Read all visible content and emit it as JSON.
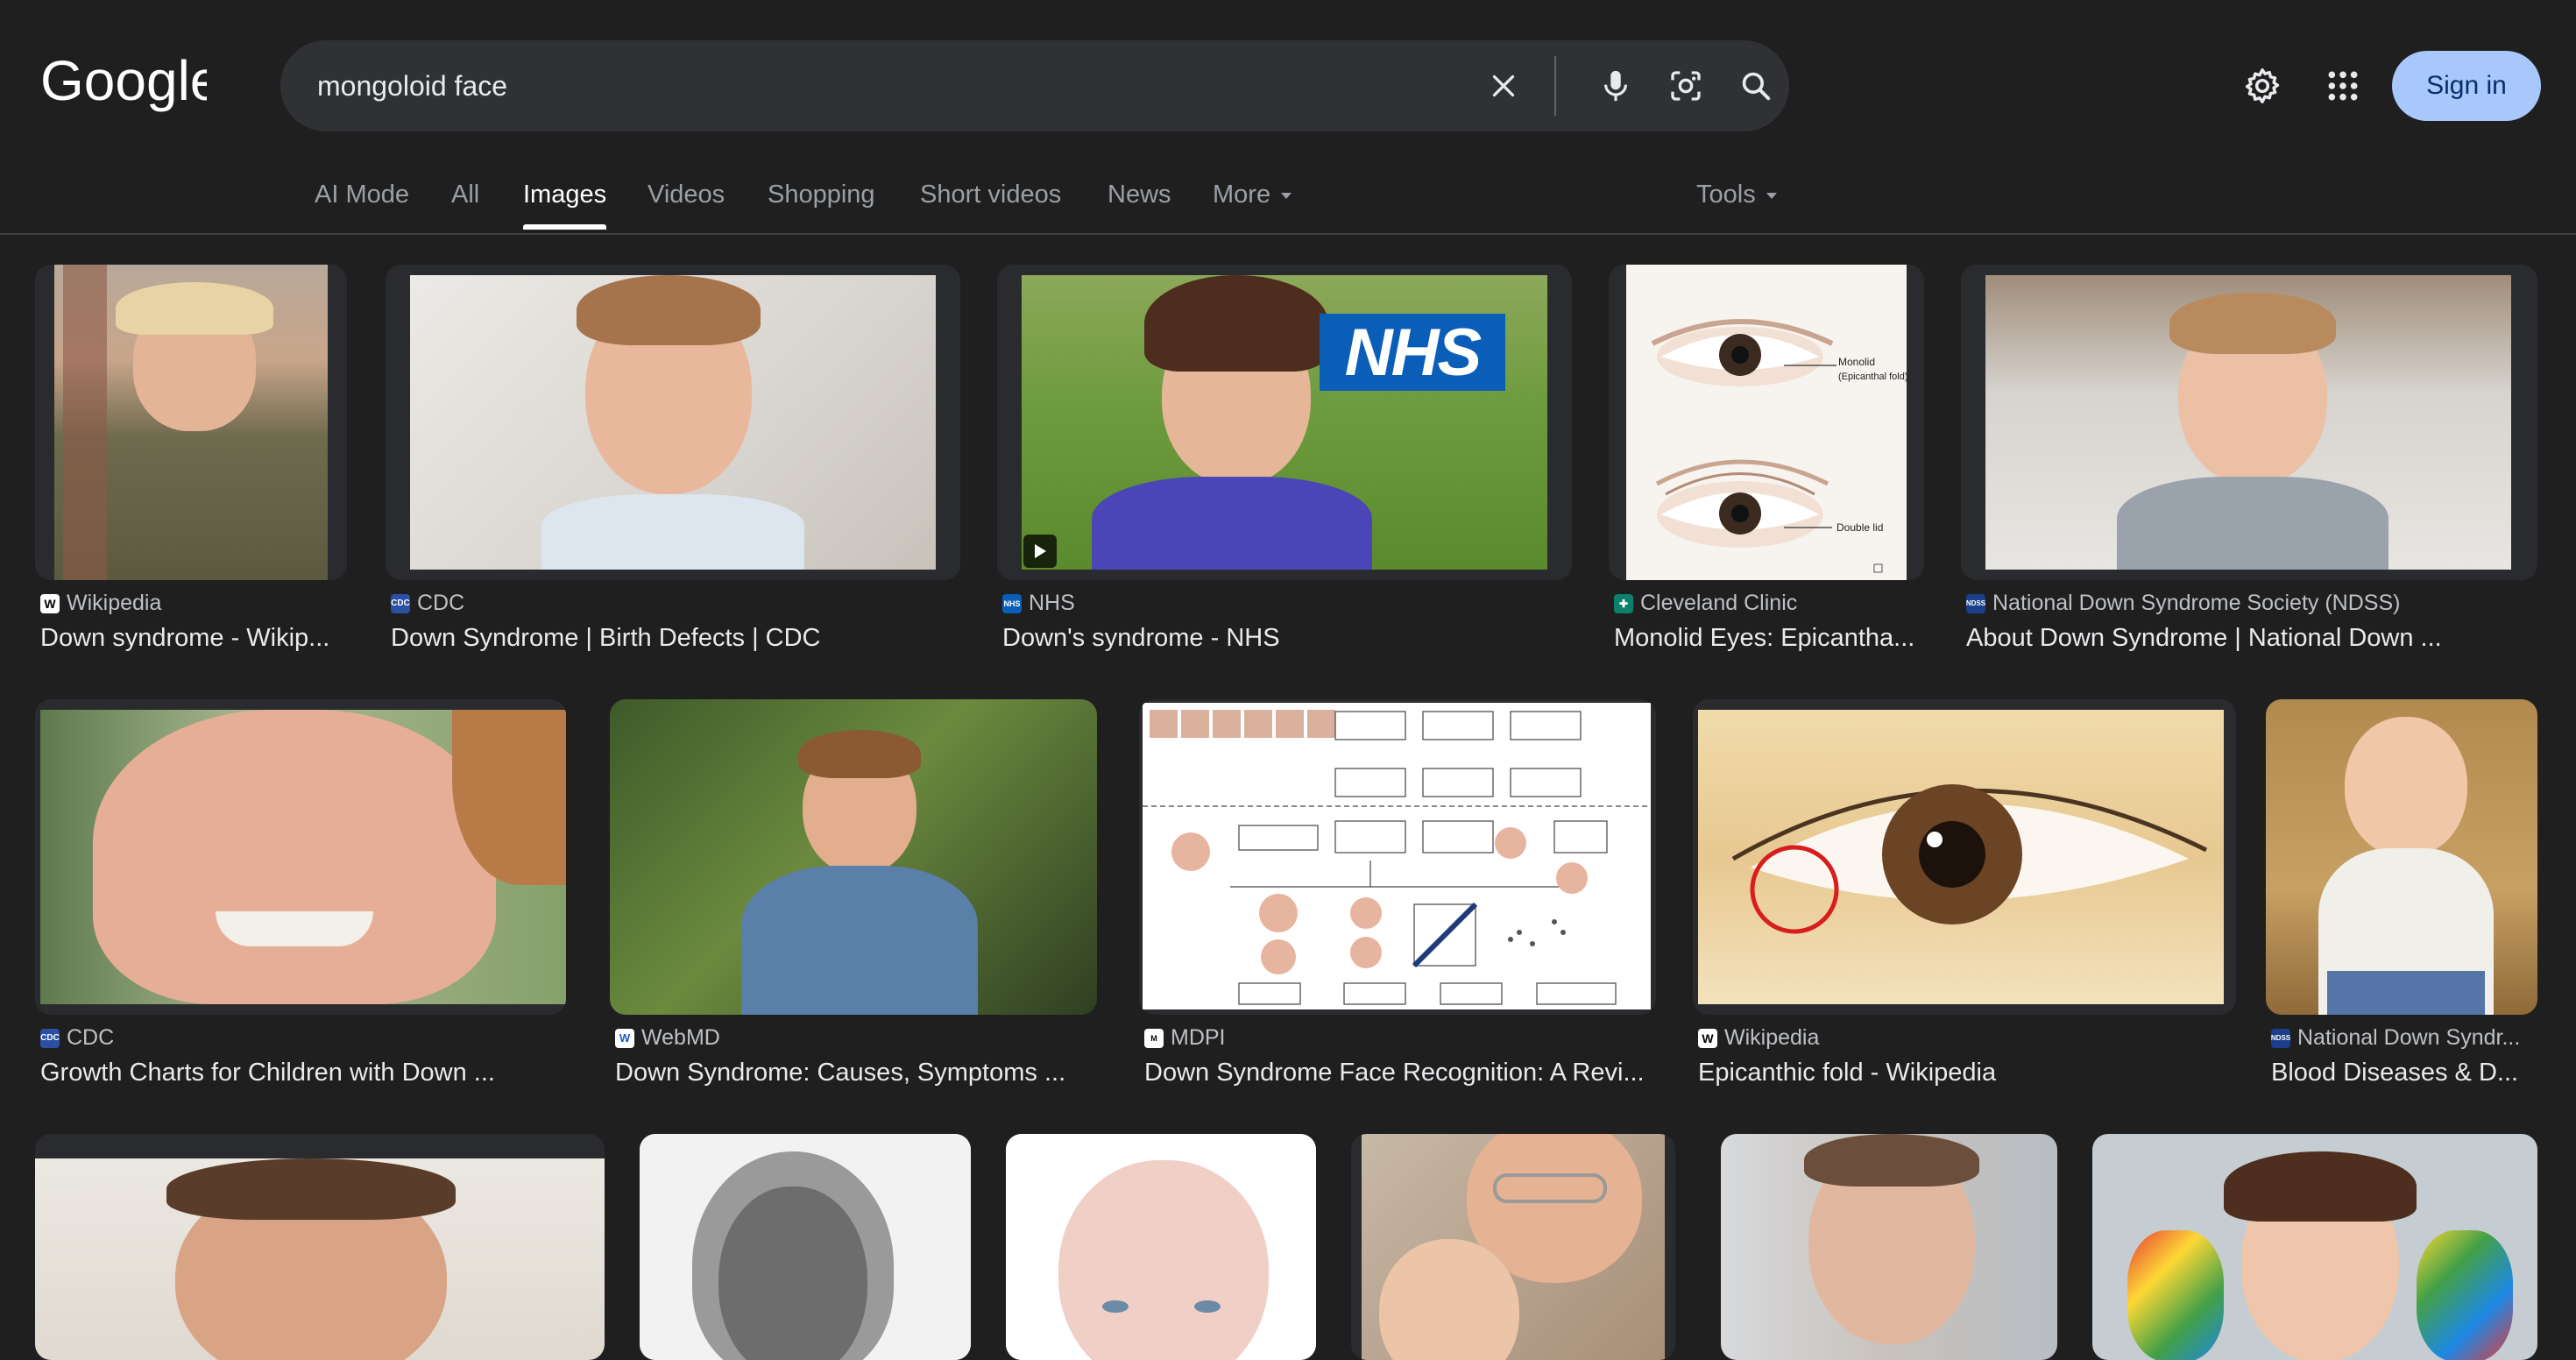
{
  "header": {
    "logo_text": "Google",
    "search_query": "mongoloid face",
    "sign_in_label": "Sign in"
  },
  "tabs": [
    {
      "label": "AI Mode"
    },
    {
      "label": "All"
    },
    {
      "label": "Images",
      "active": true
    },
    {
      "label": "Videos"
    },
    {
      "label": "Shopping"
    },
    {
      "label": "Short videos"
    },
    {
      "label": "News"
    },
    {
      "label": "More"
    },
    {
      "label": "Tools"
    }
  ],
  "results": [
    {
      "source": "Wikipedia",
      "title": "Down syndrome - Wikip..."
    },
    {
      "source": "CDC",
      "title": "Down Syndrome | Birth Defects | CDC"
    },
    {
      "source": "NHS",
      "title": "Down's syndrome - NHS",
      "image_text": "NHS"
    },
    {
      "source": "Cleveland Clinic",
      "title": "Monolid Eyes: Epicantha...",
      "image_labels": [
        "Monolid",
        "(Epicanthal fold)",
        "Double lid"
      ]
    },
    {
      "source": "National Down Syndrome Society (NDSS)",
      "title": "About Down Syndrome | National Down ..."
    },
    {
      "source": "CDC",
      "title": "Growth Charts for Children with Down ..."
    },
    {
      "source": "WebMD",
      "title": "Down Syndrome: Causes, Symptoms ..."
    },
    {
      "source": "MDPI",
      "title": "Down Syndrome Face Recognition: A Revi..."
    },
    {
      "source": "Wikipedia",
      "title": "Epicanthic fold - Wikipedia"
    },
    {
      "source": "National Down Syndr...",
      "title": "Blood Diseases & D..."
    }
  ],
  "colors": {
    "background": "#1f1f1f",
    "search_bg": "#303134",
    "sign_in_bg": "#a8c7fa",
    "text_primary": "#e8eaed",
    "text_secondary": "#9aa0a6"
  }
}
